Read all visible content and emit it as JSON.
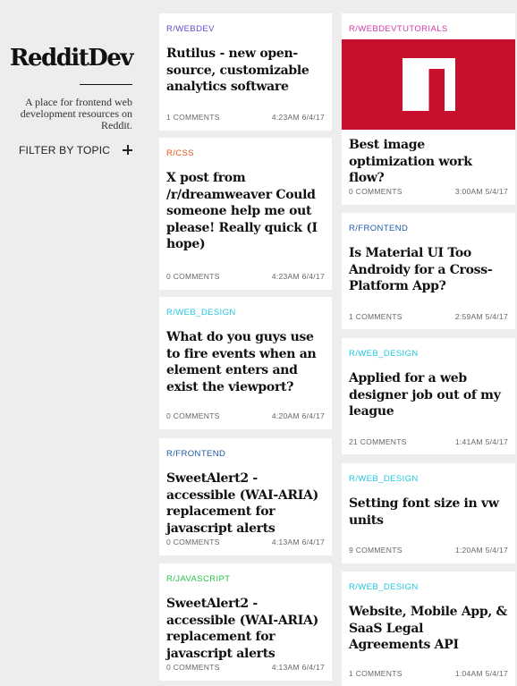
{
  "sidebar": {
    "logo": "RedditDev",
    "tagline": "A place for frontend web development resources on Reddit.",
    "filter_label": "FILTER BY TOPIC"
  },
  "posts": [
    {
      "subreddit": "R/WEBDEV",
      "color": "#5a4fcf",
      "title": "Rutilus - new open-source, customizable analytics software",
      "comments": "1 COMMENTS",
      "time": "4:23AM 6/4/17"
    },
    {
      "subreddit": "R/CSS",
      "color": "#e0541c",
      "title": "X post from /r/dreamweaver Could someone help me out please! Really quick (I hope)",
      "comments": "0 COMMENTS",
      "time": "4:23AM 6/4/17"
    },
    {
      "subreddit": "R/WEB_DESIGN",
      "color": "#22c7e0",
      "title": "What do you guys use to fire events when an element enters and exist the viewport?",
      "comments": "0 COMMENTS",
      "time": "4:20AM 6/4/17"
    },
    {
      "subreddit": "R/FRONTEND",
      "color": "#1e5aa8",
      "title": "SweetAlert2 - accessible (WAI-ARIA) replacement for javascript alerts",
      "comments": "0 COMMENTS",
      "time": "4:13AM 6/4/17"
    },
    {
      "subreddit": "R/JAVASCRIPT",
      "color": "#27c24c",
      "title": "SweetAlert2 - accessible (WAI-ARIA) replacement for javascript alerts",
      "comments": "0 COMMENTS",
      "time": "4:13AM 6/4/17"
    },
    {
      "subreddit": "R/WEBDEVTUTORIALS",
      "color": "#d63aa8",
      "title": "Best image optimization work flow?",
      "comments": "0 COMMENTS",
      "time": "3:00AM 5/4/17",
      "thumb_icon": "npm-logo-icon"
    },
    {
      "subreddit": "R/FRONTEND",
      "color": "#1e5aa8",
      "title": "Is Material UI Too Androidy for a Cross-Platform App?",
      "comments": "1 COMMENTS",
      "time": "2:59AM 5/4/17"
    },
    {
      "subreddit": "R/WEB_DESIGN",
      "color": "#22c7e0",
      "title": "Applied for a web designer job out of my league",
      "comments": "21 COMMENTS",
      "time": "1:41AM 5/4/17"
    },
    {
      "subreddit": "R/WEB_DESIGN",
      "color": "#22c7e0",
      "title": "Setting font size in vw units",
      "comments": "9 COMMENTS",
      "time": "1:20AM 5/4/17"
    },
    {
      "subreddit": "R/WEB_DESIGN",
      "color": "#22c7e0",
      "title": "Website, Mobile App, & SaaS Legal Agreements API",
      "comments": "1 COMMENTS",
      "time": "1:04AM 5/4/17"
    }
  ],
  "thumb_color": "#c8102e"
}
